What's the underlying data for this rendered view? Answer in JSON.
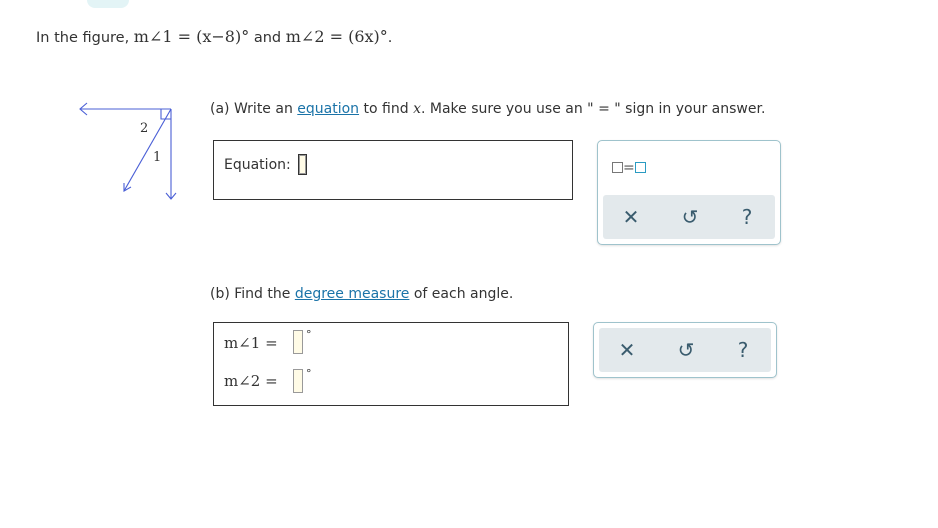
{
  "problem": {
    "intro": "In the figure,",
    "expr1": "m∠1 = (x−8)°",
    "joiner": "and",
    "expr2": "m∠2 = (6x)°",
    "end": "."
  },
  "figure": {
    "label_2": "2",
    "label_1": "1"
  },
  "part_a": {
    "prefix": "(a) Write an",
    "link": "equation",
    "mid": "to find",
    "var": "x",
    "suffix": ". Make sure you use an \" = \" sign in your answer.",
    "equation_label": "Equation:",
    "equation_value": ""
  },
  "part_b": {
    "prefix": "(b) Find the",
    "link": "degree measure",
    "suffix": "of each angle.",
    "angle1_label": "m∠1 =",
    "angle2_label": "m∠2 =",
    "deg_symbol": "°"
  },
  "toolbar": {
    "template_label": "=",
    "clear_glyph": "✕",
    "undo_glyph": "↺",
    "help_glyph": "?"
  }
}
